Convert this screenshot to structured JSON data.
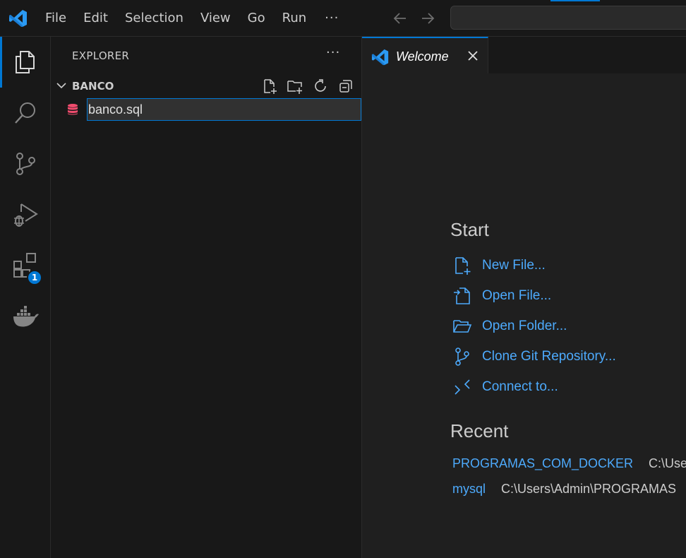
{
  "titlebar": {
    "menu": [
      "File",
      "Edit",
      "Selection",
      "View",
      "Go",
      "Run"
    ],
    "more": "···",
    "icons": [
      "vscode-logo",
      "arrow-left-icon",
      "arrow-right-icon"
    ]
  },
  "activitybar": {
    "items": [
      "explorer-icon",
      "search-icon",
      "source-control-icon",
      "run-debug-icon",
      "extensions-icon",
      "docker-icon"
    ],
    "extensions_badge": "1",
    "accent": "#0078d4"
  },
  "sidebar": {
    "title": "EXPLORER",
    "more": "···",
    "folder": {
      "name": "BANCO",
      "actions": [
        "new-file-icon",
        "new-folder-icon",
        "refresh-icon",
        "collapse-all-icon"
      ]
    },
    "rename_value": "banco.sql",
    "file_icon_color": "#f14c6e"
  },
  "tabs": [
    {
      "label": "Welcome",
      "icon": "vscode-logo"
    }
  ],
  "welcome": {
    "start_title": "Start",
    "start": [
      {
        "label": "New File...",
        "icon": "new-file-icon"
      },
      {
        "label": "Open File...",
        "icon": "open-file-icon"
      },
      {
        "label": "Open Folder...",
        "icon": "open-folder-icon"
      },
      {
        "label": "Clone Git Repository...",
        "icon": "git-branch-icon"
      },
      {
        "label": "Connect to...",
        "icon": "remote-icon"
      }
    ],
    "recent_title": "Recent",
    "recent": [
      {
        "name": "PROGRAMAS_COM_DOCKER",
        "path": "C:\\Users"
      },
      {
        "name": "mysql",
        "path": "C:\\Users\\Admin\\PROGRAMAS"
      }
    ],
    "link_color": "#4daafc"
  }
}
